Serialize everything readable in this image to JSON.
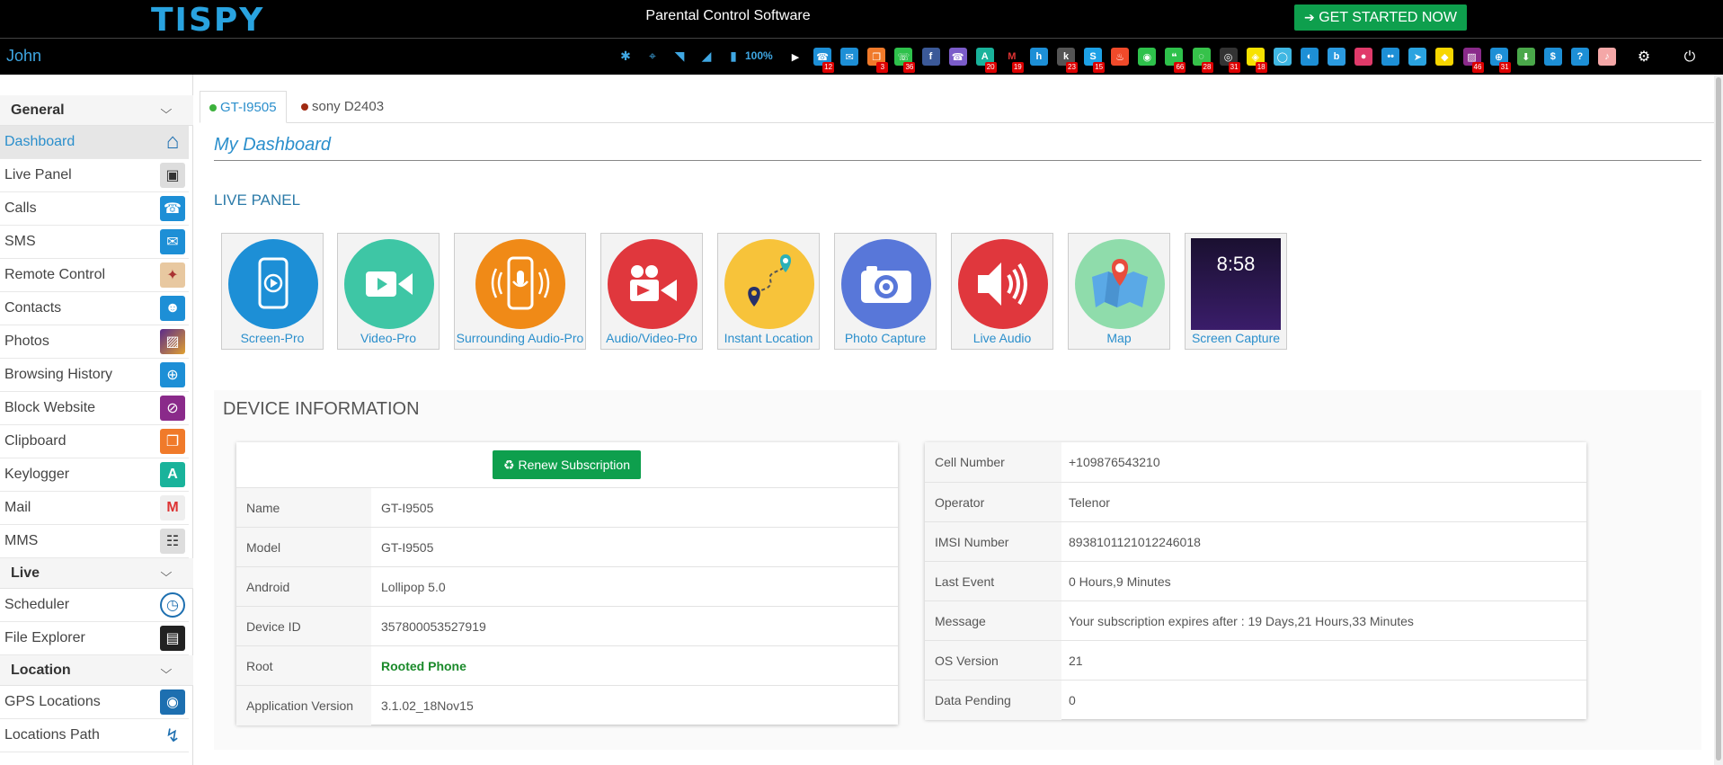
{
  "header": {
    "logo": "TISPY",
    "title": "Parental Control Software",
    "cta_icon": "sign-in-icon",
    "cta_label": "GET STARTED NOW"
  },
  "statusbar": {
    "user": "John",
    "battery_text": "100%",
    "device_icons": [
      "bluetooth-icon",
      "gps-icon",
      "wifi-icon",
      "signal-icon",
      "battery-icon"
    ],
    "apps": [
      {
        "name": "video-call-app-icon",
        "badge": ""
      },
      {
        "name": "calls-app-icon",
        "badge": "12"
      },
      {
        "name": "sms-app-icon",
        "badge": ""
      },
      {
        "name": "clipboard-app-icon",
        "badge": "3"
      },
      {
        "name": "whatsapp-app-icon",
        "badge": "36"
      },
      {
        "name": "facebook-app-icon",
        "badge": ""
      },
      {
        "name": "viber-app-icon",
        "badge": ""
      },
      {
        "name": "keylogger-app-icon",
        "badge": "20"
      },
      {
        "name": "gmail-app-icon",
        "badge": "19"
      },
      {
        "name": "hike-app-icon",
        "badge": ""
      },
      {
        "name": "kik-app-icon",
        "badge": "23"
      },
      {
        "name": "skype-app-icon",
        "badge": "15"
      },
      {
        "name": "tinder-app-icon",
        "badge": ""
      },
      {
        "name": "wechat-app-icon",
        "badge": ""
      },
      {
        "name": "hangouts-app-icon",
        "badge": "66"
      },
      {
        "name": "line-app-icon",
        "badge": "28"
      },
      {
        "name": "instagram-app-icon",
        "badge": "31"
      },
      {
        "name": "snapchat-app-icon",
        "badge": "18"
      },
      {
        "name": "imo-app-icon",
        "badge": ""
      },
      {
        "name": "zalo-app-icon",
        "badge": ""
      },
      {
        "name": "bip-app-icon",
        "badge": ""
      },
      {
        "name": "video-app-icon",
        "badge": ""
      },
      {
        "name": "flickr-app-icon",
        "badge": ""
      },
      {
        "name": "telegram-app-icon",
        "badge": ""
      },
      {
        "name": "kakao-app-icon",
        "badge": ""
      },
      {
        "name": "photos-app-icon",
        "badge": "46"
      },
      {
        "name": "browser-app-icon",
        "badge": "31"
      },
      {
        "name": "download-app-icon",
        "badge": ""
      },
      {
        "name": "money-app-icon",
        "badge": ""
      },
      {
        "name": "help-app-icon",
        "badge": ""
      },
      {
        "name": "alert-app-icon",
        "badge": ""
      }
    ]
  },
  "sidebar": {
    "sections": [
      {
        "label": "General",
        "items": [
          "Dashboard",
          "Live Panel",
          "Calls",
          "SMS",
          "Remote Control",
          "Contacts",
          "Photos",
          "Browsing History",
          "Block Website",
          "Clipboard",
          "Keylogger",
          "Mail",
          "MMS"
        ]
      },
      {
        "label": "Live",
        "items": [
          "Scheduler",
          "File Explorer"
        ]
      },
      {
        "label": "Location",
        "items": [
          "GPS Locations",
          "Locations Path"
        ]
      }
    ],
    "active_item": "Dashboard"
  },
  "tabs": [
    {
      "label": "GT-I9505",
      "status_color": "#3cb13c",
      "active": true
    },
    {
      "label": "sony D2403",
      "status_color": "#a02a12",
      "active": false
    }
  ],
  "dashboard": {
    "title": "My Dashboard",
    "live_panel_heading": "LIVE PANEL",
    "tiles": [
      {
        "label": "Screen-Pro",
        "color": "#1d8fd6",
        "icon": "phone-play-icon"
      },
      {
        "label": "Video-Pro",
        "color": "#3ec6a5",
        "icon": "video-camera-icon"
      },
      {
        "label": "Surrounding Audio-Pro",
        "color": "#f08a17",
        "icon": "phone-mic-icon"
      },
      {
        "label": "Audio/Video-Pro",
        "color": "#e0373d",
        "icon": "video-user-icon"
      },
      {
        "label": "Instant Location",
        "color": "#f7c33a",
        "icon": "route-pin-icon"
      },
      {
        "label": "Photo Capture",
        "color": "#5877d9",
        "icon": "photo-camera-icon"
      },
      {
        "label": "Live Audio",
        "color": "#e0373d",
        "icon": "speaker-icon"
      },
      {
        "label": "Map",
        "color": "#8fdcab",
        "icon": "map-pin-icon"
      },
      {
        "label": "Screen Capture",
        "color": "#2b1a4d",
        "icon": "lockscreen-thumbnail",
        "lock_time": "8:58"
      }
    ]
  },
  "device_info": {
    "title": "DEVICE INFORMATION",
    "renew_label": "Renew Subscription",
    "left": [
      {
        "key": "Name",
        "value": "GT-I9505"
      },
      {
        "key": "Model",
        "value": "GT-I9505"
      },
      {
        "key": "Android",
        "value": "Lollipop 5.0"
      },
      {
        "key": "Device ID",
        "value": "357800053527919"
      },
      {
        "key": "Root",
        "value": "Rooted Phone"
      },
      {
        "key": "Application Version",
        "value": "3.1.02_18Nov15"
      }
    ],
    "root_color": "#1a8a2a",
    "right": [
      {
        "key": "Cell Number",
        "value": "+109876543210"
      },
      {
        "key": "Operator",
        "value": "Telenor"
      },
      {
        "key": "IMSI Number",
        "value": "8938101121012246018"
      },
      {
        "key": "Last Event",
        "value": "0 Hours,9 Minutes"
      },
      {
        "key": "Message",
        "value": "Your subscription expires after : 19 Days,21 Hours,33 Minutes"
      },
      {
        "key": "OS Version",
        "value": "21"
      },
      {
        "key": "Data Pending",
        "value": "0"
      }
    ]
  }
}
